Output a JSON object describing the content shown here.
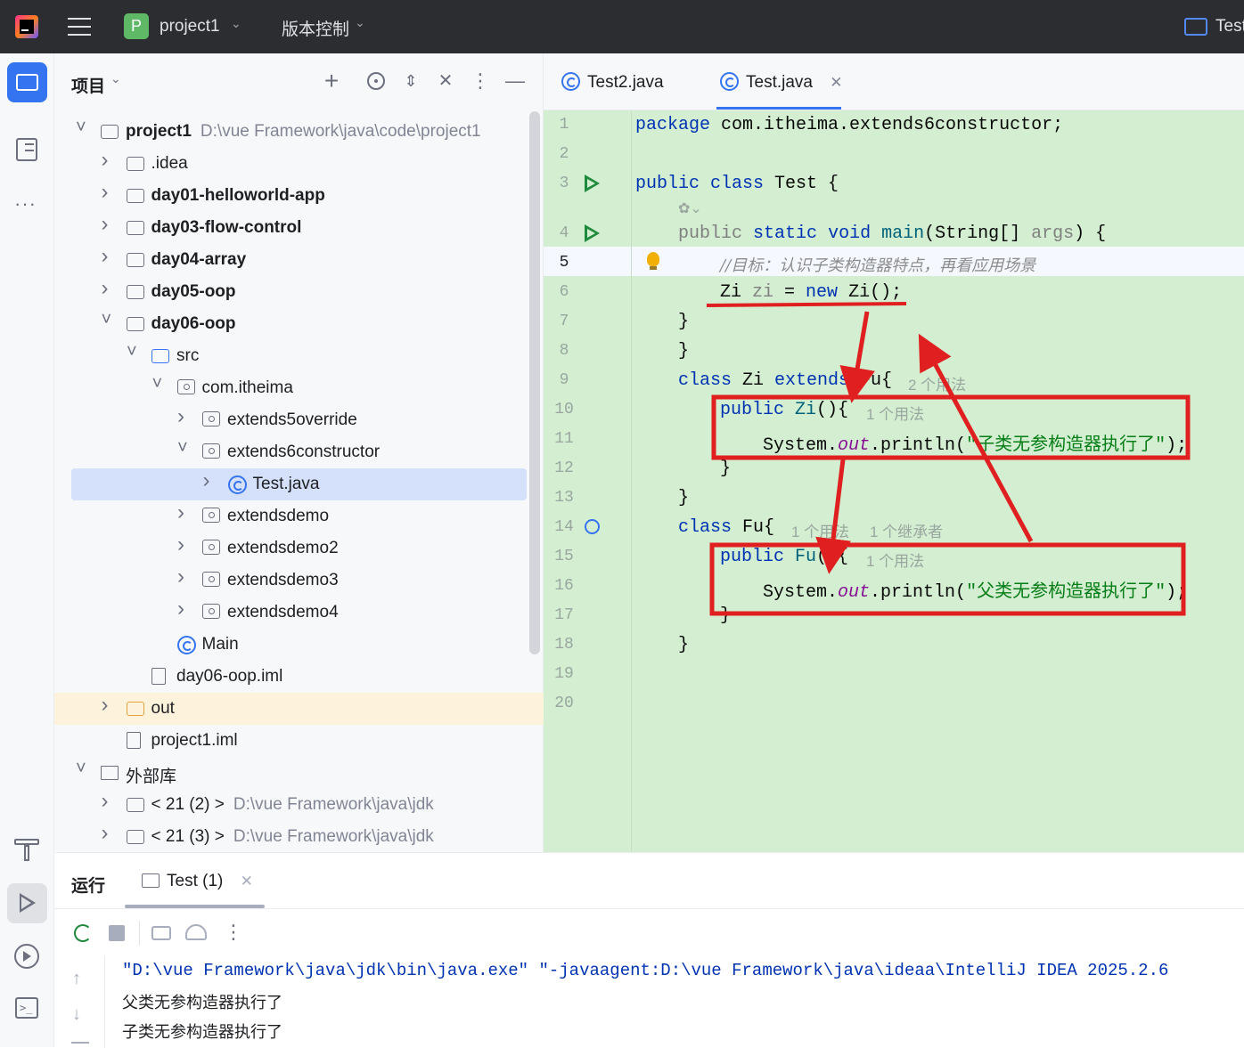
{
  "titlebar": {
    "project_initial": "P",
    "project_name": "project1",
    "vcs_label": "版本控制",
    "run_config": "Test"
  },
  "project_panel": {
    "title": "项目",
    "tree": [
      {
        "label": "project1",
        "path": "D:\\vue  Framework\\java\\code\\project1",
        "type": "module",
        "bold": true
      },
      {
        "label": ".idea",
        "type": "folder"
      },
      {
        "label": "day01-helloworld-app",
        "type": "module",
        "bold": true
      },
      {
        "label": "day03-flow-control",
        "type": "module",
        "bold": true
      },
      {
        "label": "day04-array",
        "type": "module",
        "bold": true
      },
      {
        "label": "day05-oop",
        "type": "module",
        "bold": true
      },
      {
        "label": "day06-oop",
        "type": "module",
        "bold": true
      },
      {
        "label": "src",
        "type": "src"
      },
      {
        "label": "com.itheima",
        "type": "package"
      },
      {
        "label": "extends5override",
        "type": "package"
      },
      {
        "label": "extends6constructor",
        "type": "package"
      },
      {
        "label": "Test.java",
        "type": "class",
        "selected": true
      },
      {
        "label": "extendsdemo",
        "type": "package"
      },
      {
        "label": "extendsdemo2",
        "type": "package"
      },
      {
        "label": "extendsdemo3",
        "type": "package"
      },
      {
        "label": "extendsdemo4",
        "type": "package"
      },
      {
        "label": "Main",
        "type": "class"
      },
      {
        "label": "day06-oop.iml",
        "type": "file"
      },
      {
        "label": "out",
        "type": "out-folder"
      },
      {
        "label": "project1.iml",
        "type": "file"
      },
      {
        "label": "外部库",
        "type": "library"
      },
      {
        "label": "< 21 (2) >",
        "path": "D:\\vue  Framework\\java\\jdk",
        "type": "jdk"
      },
      {
        "label": "< 21 (3) >",
        "path": "D:\\vue  Framework\\java\\jdk",
        "type": "jdk"
      }
    ]
  },
  "editor": {
    "tabs": [
      {
        "label": "Test2.java"
      },
      {
        "label": "Test.java",
        "active": true
      }
    ],
    "line_numbers": [
      "1",
      "2",
      "3",
      "4",
      "5",
      "6",
      "7",
      "8",
      "9",
      "10",
      "11",
      "12",
      "13",
      "14",
      "15",
      "16",
      "17",
      "18",
      "19",
      "20"
    ],
    "code": {
      "l1_kw": "package",
      "l1_rest": " com.itheima.extends6constructor;",
      "l3_kw1": "public",
      "l3_kw2": "class",
      "l3_rest": " Test {",
      "l4_a": "public",
      "l4_b": "static",
      "l4_c": "void",
      "l4_d": " main",
      "l4_e": "(String[] ",
      "l4_f": "args",
      "l4_g": ") {",
      "l5_comment": "//目标：认识子类构造器特点，再看应用场景",
      "l6_a": "Zi ",
      "l6_b": "zi",
      "l6_c": " = ",
      "l6_d": "new",
      "l6_e": " Zi();",
      "l7": "}",
      "l8": "}",
      "l9_a": "class",
      "l9_b": " Zi ",
      "l9_c": "extends",
      "l9_d": " Fu{",
      "l10_a": "public",
      "l10_b": " Zi",
      "l10_c": "(){",
      "l11_a": "System.",
      "l11_b": "out",
      "l11_c": ".println(",
      "l11_d": "\"子类无参构造器执行了\"",
      "l11_e": ");",
      "l12": "}",
      "l13": "}",
      "l14_a": "class",
      "l14_b": " Fu{",
      "l15_a": "public",
      "l15_b": " Fu",
      "l15_c": "(){",
      "l16_a": "System.",
      "l16_b": "out",
      "l16_c": ".println(",
      "l16_d": "\"父类无参构造器执行了\"",
      "l16_e": ");",
      "l17": "}",
      "l18": "}"
    },
    "hints": {
      "zi_class": "2 个用法",
      "zi_ctor": "1 个用法",
      "fu_class": "1 个用法",
      "fu_inheritors": "1 个继承者",
      "fu_ctor": "1 个用法"
    },
    "annotation_color": "#e02020"
  },
  "run_panel": {
    "title": "运行",
    "tab_label": "Test (1)",
    "output": [
      "\"D:\\vue  Framework\\java\\jdk\\bin\\java.exe\" \"-javaagent:D:\\vue  Framework\\java\\ideaa\\IntelliJ IDEA 2025.2.6",
      "父类无参构造器执行了",
      "子类无参构造器执行了"
    ]
  }
}
